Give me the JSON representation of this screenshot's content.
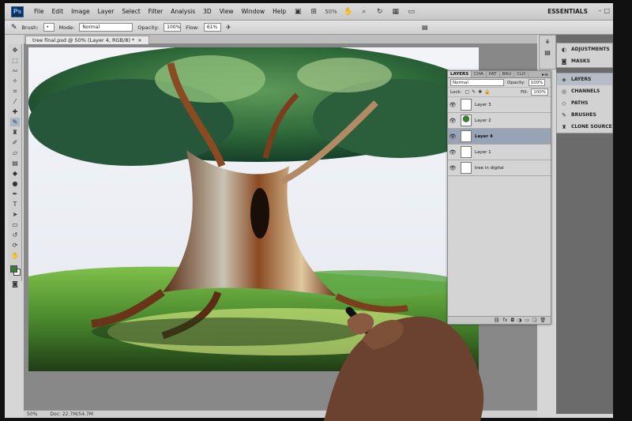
{
  "app": {
    "logo": "Ps",
    "menu": [
      "File",
      "Edit",
      "Image",
      "Layer",
      "Select",
      "Filter",
      "Analysis",
      "3D",
      "View",
      "Window",
      "Help"
    ],
    "zoom": "50%",
    "workspace": "ESSENTIALS"
  },
  "options": {
    "brush_label": "Brush:",
    "mode_label": "Mode:",
    "mode_value": "Normal",
    "opacity_label": "Opacity:",
    "opacity_value": "100%",
    "flow_label": "Flow:",
    "flow_value": "61%"
  },
  "document": {
    "tab_title": "tree final.psd @ 50% (Layer 4, RGB/8) *",
    "status_zoom": "50%",
    "status_doc": "Doc: 22.7M/54.7M"
  },
  "dock": {
    "top": [
      {
        "label": "ADJUSTMENTS",
        "icon": "adjustments-icon"
      },
      {
        "label": "MASKS",
        "icon": "masks-icon"
      }
    ],
    "bottom": [
      {
        "label": "LAYERS",
        "icon": "layers-icon",
        "active": true
      },
      {
        "label": "CHANNELS",
        "icon": "channels-icon"
      },
      {
        "label": "PATHS",
        "icon": "paths-icon"
      },
      {
        "label": "BRUSHES",
        "icon": "brushes-icon"
      },
      {
        "label": "CLONE SOURCE",
        "icon": "clone-source-icon"
      }
    ]
  },
  "layers_panel": {
    "tabs": [
      "LAYERS",
      "CHA",
      "PAT",
      "BRU",
      "CLO"
    ],
    "blend_mode": "Normal",
    "opacity_label": "Opacity:",
    "opacity_value": "100%",
    "lock_label": "Lock:",
    "fill_label": "Fill:",
    "fill_value": "100%",
    "layers": [
      {
        "name": "Layer 3",
        "selected": false
      },
      {
        "name": "Layer 2",
        "selected": false
      },
      {
        "name": "Layer 4",
        "selected": true
      },
      {
        "name": "Layer 1",
        "selected": false
      },
      {
        "name": "tree in digital",
        "selected": false
      }
    ]
  },
  "colors": {
    "foreground": "#3a7a3a",
    "background": "#ffffff",
    "selection": "#98a4b6"
  }
}
